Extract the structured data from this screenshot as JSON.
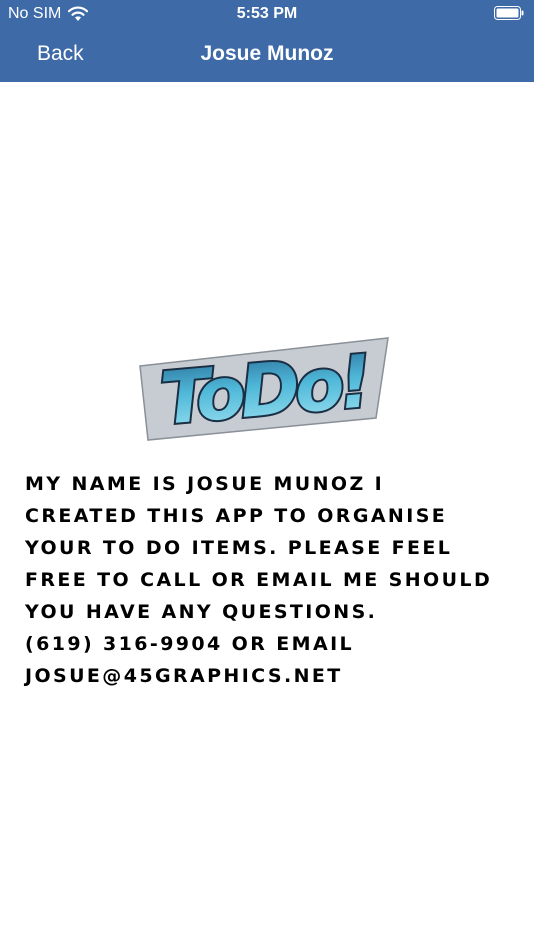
{
  "status_bar": {
    "carrier": "No SIM",
    "time": "5:53 PM"
  },
  "nav": {
    "back_label": "Back",
    "title": "Josue Munoz"
  },
  "logo": {
    "text": "ToDo!"
  },
  "about": {
    "lines": [
      "My name is Josue Munoz I",
      "created this app to organise",
      "your to do items. Please feel",
      "free to call or email me should",
      "you have any questions.",
      "(619) 316-9904 or email",
      "josue@45graphics.net"
    ]
  },
  "colors": {
    "header": "#3e6aa8",
    "logo_fill": "#4fb8d8",
    "logo_outline": "#1a2e44"
  }
}
